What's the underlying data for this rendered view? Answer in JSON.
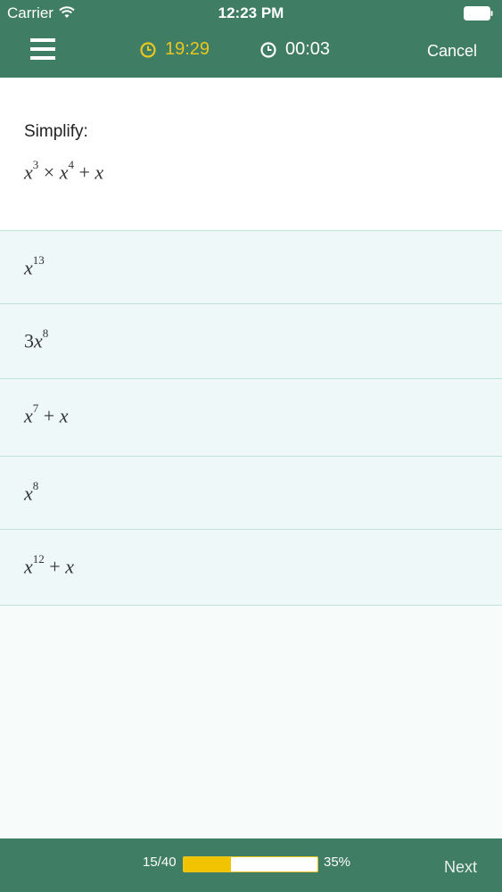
{
  "status_bar": {
    "carrier": "Carrier",
    "time": "12:23 PM"
  },
  "header": {
    "timer_remaining": "19:29",
    "timer_elapsed": "00:03",
    "cancel_label": "Cancel",
    "timer_remaining_color": "#e9c620",
    "bar_color": "#3f7d65"
  },
  "question": {
    "prompt": "Simplify:",
    "expression": "x^3 × x^4 + x"
  },
  "answers": [
    {
      "text": "x^13"
    },
    {
      "text": "3x^8"
    },
    {
      "text": "x^7 + x"
    },
    {
      "text": "x^8"
    },
    {
      "text": "x^12 + x"
    }
  ],
  "footer": {
    "page_count": "15/40",
    "progress_label": "35%",
    "progress_fraction": 0.35,
    "next_label": "Next"
  },
  "icons": [
    "menu-icon",
    "wifi-icon",
    "battery-icon",
    "clock-icon"
  ]
}
